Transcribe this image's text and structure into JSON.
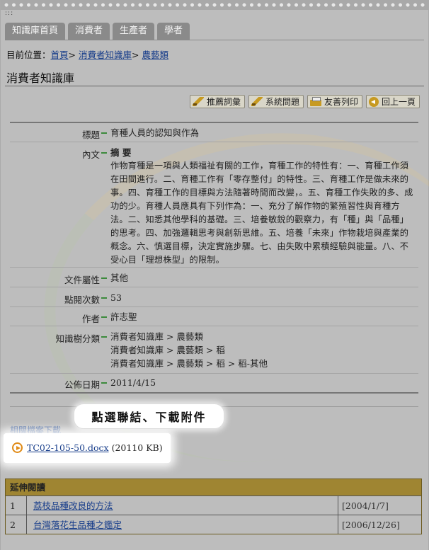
{
  "dots_label": ":::",
  "tabs": [
    {
      "label": "知識庫首頁"
    },
    {
      "label": "消費者"
    },
    {
      "label": "生產者"
    },
    {
      "label": "學者"
    }
  ],
  "breadcrumb": {
    "prefix": "目前位置：",
    "items": [
      "首頁",
      "消費者知識庫",
      "農藝類"
    ],
    "sep": ">"
  },
  "page_title": "消費者知識庫",
  "toolbar": {
    "recommend": "推薦詞彙",
    "system_issue": "系統問題",
    "print": "友善列印",
    "back": "回上一頁"
  },
  "record": {
    "title_label": "標題",
    "title": "育種人員的認知與作為",
    "content_label": "內文",
    "abstract_head": "摘 要",
    "abstract": "作物育種是一項與人類福祉有關的工作，育種工作的特性有：一、育種工作須在田間進行。二、育種工作有「零存整付」的特性。三、育種工作是做未來的事。四、育種工作的目標與方法隨著時間而改變，。五、育種工作失敗的多、成功的少。育種人員應具有下列作為：一、充分了解作物的繁殖習性與育種方法。二、知悉其他學科的基礎。三、培養敏銳的觀察力，有「種」與「品種」的思考。四、加強邏輯思考與創新思維。五、培養「未來」作物栽培與產業的概念。六、慎選目標，決定實施步驟。七、由失敗中累積經驗與能量。八、不受心目「理想株型」的限制。",
    "attr_label": "文件屬性",
    "attr": "其他",
    "views_label": "點閱次數",
    "views": "53",
    "author_label": "作者",
    "author": "許志聖",
    "tree_label": "知識樹分類",
    "tree": [
      "消費者知識庫 > 農藝類",
      "消費者知識庫 > 農藝類 > 稻",
      "消費者知識庫 > 農藝類 > 稻 > 稻-其他"
    ],
    "date_label": "公佈日期",
    "date": "2011/4/15"
  },
  "callout": "點選聯結、下載附件",
  "downloads": {
    "label": "相關檔案下載",
    "file_name": "TC02-105-50.docx",
    "file_size": "(20110 KB)"
  },
  "extended": {
    "header": "延伸閱讀",
    "rows": [
      {
        "n": "1",
        "title": "荔枝品種改良的方法",
        "date": "[2004/1/7]"
      },
      {
        "n": "2",
        "title": "台灣落花生品種之鑑定",
        "date": "[2006/12/26]"
      }
    ]
  }
}
